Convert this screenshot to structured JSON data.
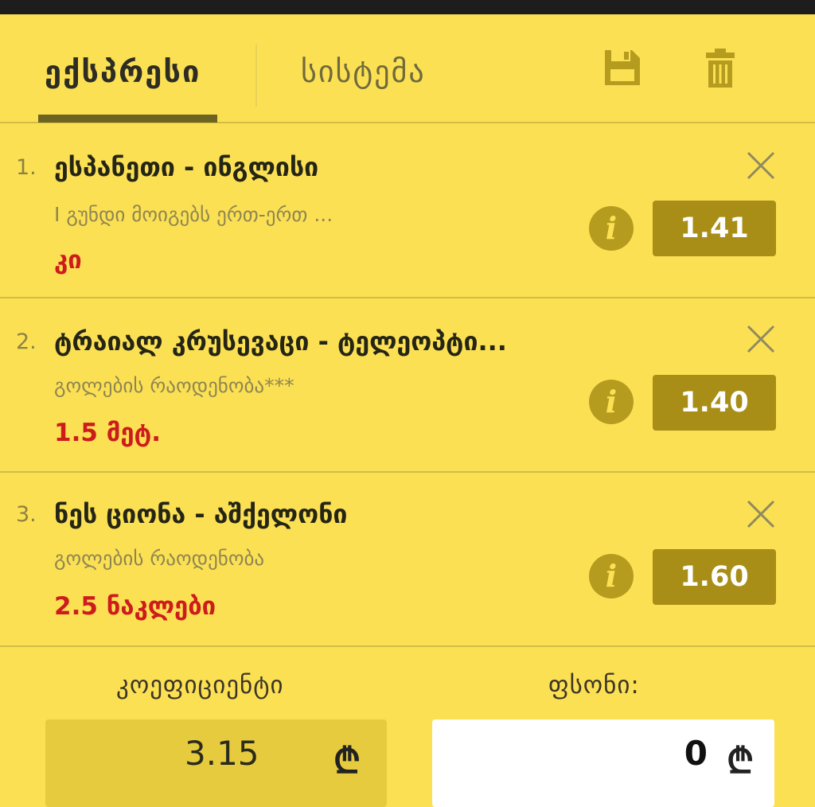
{
  "tabs": {
    "express": "ექსპრესი",
    "system": "სისტემა"
  },
  "icons": {
    "save": "floppy-disk-icon",
    "delete": "trash-icon",
    "close": "close-icon",
    "info": "info-icon"
  },
  "colors": {
    "background": "#fce054",
    "accent": "#a88e17",
    "selection_text": "#cc1c1c"
  },
  "bets": [
    {
      "number": "1.",
      "title": "ესპანეთი - ინგლისი",
      "market": "I გუნდი მოიგებს ერთ-ერთ ...",
      "selection": "კი",
      "odds": "1.41",
      "info": "i"
    },
    {
      "number": "2.",
      "title": "ტრაიალ კრუსევაცი - ტელეოპტი...",
      "market": "გოლების რაოდენობა***",
      "selection": "1.5 მეტ.",
      "odds": "1.40",
      "info": "i"
    },
    {
      "number": "3.",
      "title": "ნეს ციონა - აშქელონი",
      "market": "გოლების რაოდენობა",
      "selection": "2.5 ნაკლები",
      "odds": "1.60",
      "info": "i"
    }
  ],
  "footer": {
    "coef_label": "კოეფიციენტი",
    "stake_label": "ფსონი:",
    "coef_value": "3.15",
    "stake_value": "0",
    "currency": "₾"
  }
}
